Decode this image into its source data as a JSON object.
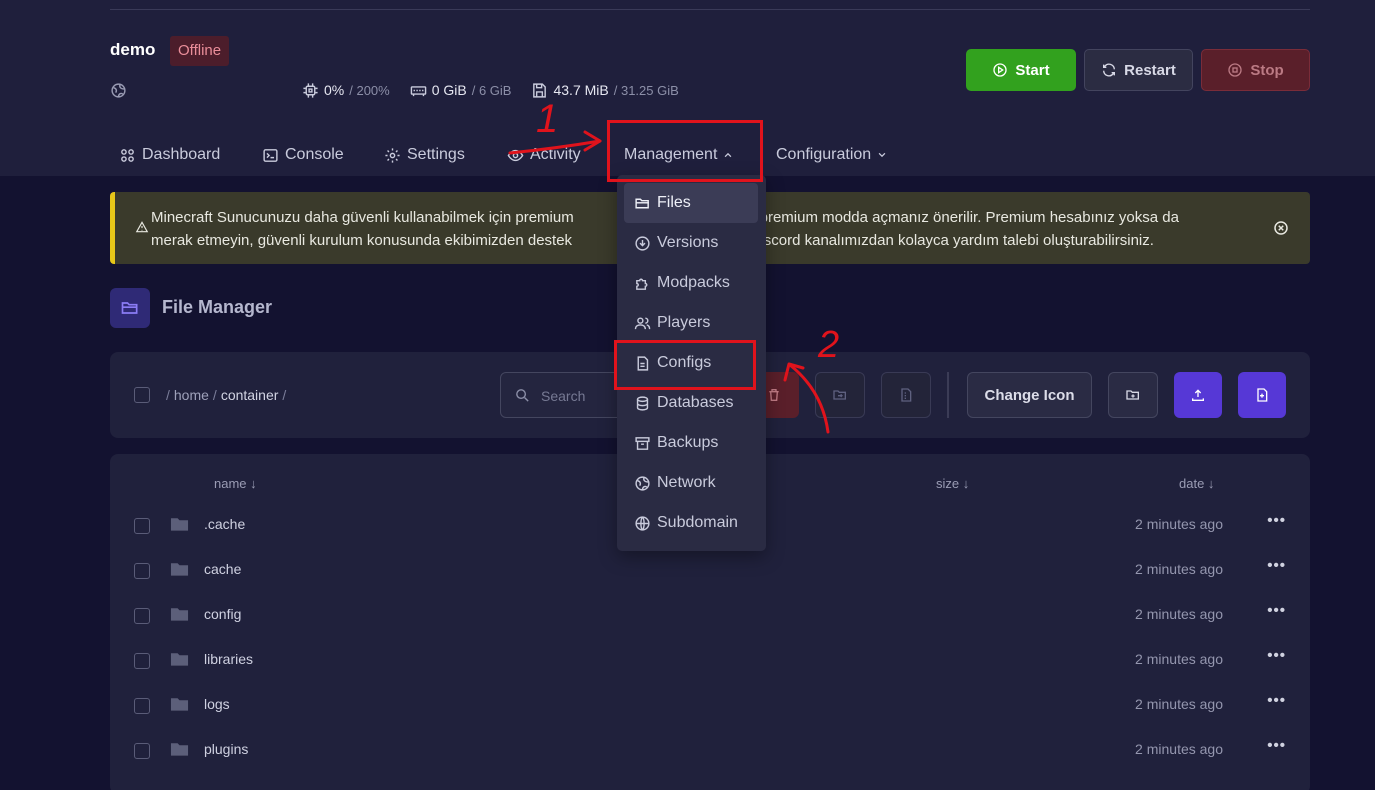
{
  "server": {
    "name": "demo",
    "status": "Offline",
    "cpu": {
      "value": "0%",
      "limit": "/ 200%"
    },
    "memory": {
      "value": "0 GiB",
      "limit": "/ 6 GiB"
    },
    "disk": {
      "value": "43.7 MiB",
      "limit": "/ 31.25 GiB"
    }
  },
  "power": {
    "start": "Start",
    "restart": "Restart",
    "stop": "Stop"
  },
  "nav": {
    "dashboard": "Dashboard",
    "console": "Console",
    "settings": "Settings",
    "activity": "Activity",
    "management": "Management",
    "configuration": "Configuration"
  },
  "management_menu": {
    "files": "Files",
    "versions": "Versions",
    "modpacks": "Modpacks",
    "players": "Players",
    "configs": "Configs",
    "databases": "Databases",
    "backups": "Backups",
    "network": "Network",
    "subdomain": "Subdomain"
  },
  "alert": {
    "line1": "Minecraft Sunucunuzu daha güvenli kullanabilmek için premium                                     laka premium modda açmanız önerilir. Premium hesabınız yoksa da",
    "line2": "merak etmeyin, güvenli kurulum konusunda ekibimizden destek                                     çin Discord kanalımızdan kolayca yardım talebi oluşturabilirsiniz."
  },
  "file_manager": {
    "title": "File Manager",
    "breadcrumb": {
      "home": "home",
      "current": "container",
      "separator": "/"
    },
    "search_placeholder": "Search",
    "change_icon": "Change Icon",
    "columns": {
      "name": "name ↓",
      "size": "size ↓",
      "date": "date ↓"
    },
    "rows": [
      {
        "name": ".cache",
        "date": "2 minutes ago"
      },
      {
        "name": "cache",
        "date": "2 minutes ago"
      },
      {
        "name": "config",
        "date": "2 minutes ago"
      },
      {
        "name": "libraries",
        "date": "2 minutes ago"
      },
      {
        "name": "logs",
        "date": "2 minutes ago"
      },
      {
        "name": "plugins",
        "date": "2 minutes ago"
      }
    ],
    "row_menu": "•••"
  },
  "annotations": {
    "step1": "1",
    "step2": "2",
    "color": "#e0131c"
  },
  "colors": {
    "accent": "#5638d6",
    "start": "#32a11e",
    "danger": "#5a1f2a",
    "warning": "#e6c619"
  }
}
